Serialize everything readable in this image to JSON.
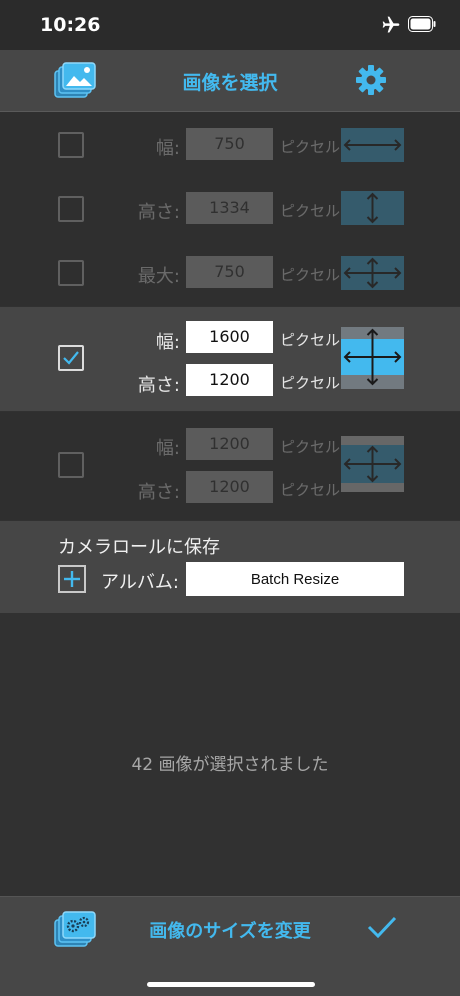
{
  "status_bar": {
    "time": "10:26",
    "icons": [
      "airplane-icon",
      "battery-icon"
    ]
  },
  "nav_bar": {
    "title": "画像を選択",
    "left_icon": "photos-icon",
    "right_icon": "gear-icon"
  },
  "accent_color": "#43b9ee",
  "options": [
    {
      "checked": false,
      "fields": [
        {
          "label": "幅:",
          "value": "750",
          "unit": "ピクセル"
        }
      ],
      "icon": "horizontal-arrow-icon"
    },
    {
      "checked": false,
      "fields": [
        {
          "label": "高さ:",
          "value": "1334",
          "unit": "ピクセル"
        }
      ],
      "icon": "vertical-arrow-icon"
    },
    {
      "checked": false,
      "fields": [
        {
          "label": "最大:",
          "value": "750",
          "unit": "ピクセル"
        }
      ],
      "icon": "four-way-arrow-icon"
    },
    {
      "checked": true,
      "fields": [
        {
          "label": "幅:",
          "value": "1600",
          "unit": "ピクセル"
        },
        {
          "label": "高さ:",
          "value": "1200",
          "unit": "ピクセル"
        }
      ],
      "icon": "four-way-arrow-icon"
    },
    {
      "checked": false,
      "fields": [
        {
          "label": "幅:",
          "value": "1200",
          "unit": "ピクセル"
        },
        {
          "label": "高さ:",
          "value": "1200",
          "unit": "ピクセル"
        }
      ],
      "icon": "four-way-arrow-icon"
    }
  ],
  "save_section": {
    "title": "カメラロールに保存",
    "album_label": "アルバム:",
    "album_value": "Batch Resize"
  },
  "selection_message": "42 画像が選択されました",
  "toolbar": {
    "left_icon": "photos-settings-icon",
    "resize_label": "画像のサイズを変更",
    "done_icon": "checkmark-icon"
  }
}
